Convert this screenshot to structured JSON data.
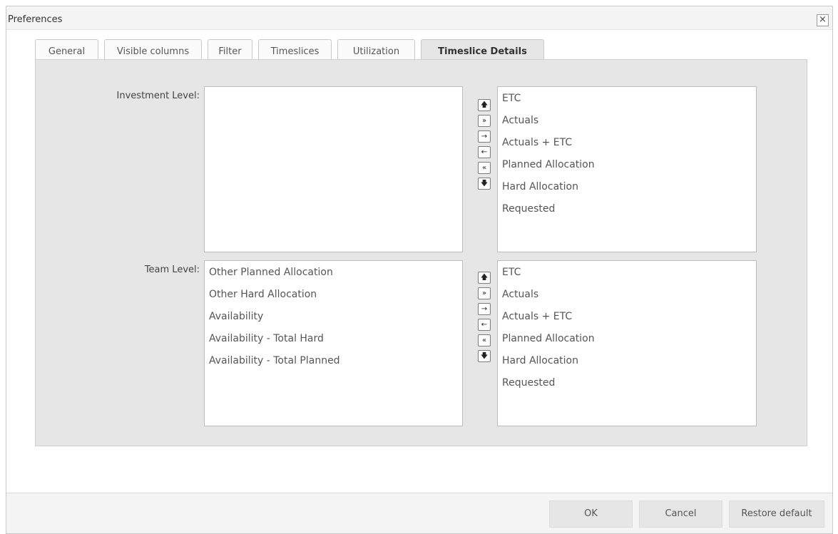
{
  "dialog": {
    "title": "Preferences",
    "close_glyph": "×"
  },
  "tabs": [
    {
      "label": "General"
    },
    {
      "label": "Visible columns"
    },
    {
      "label": "Filter"
    },
    {
      "label": "Timeslices"
    },
    {
      "label": "Utilization"
    },
    {
      "label": "Timeslice Details",
      "active": true
    }
  ],
  "investment": {
    "label": "Investment Level:",
    "available": [],
    "selected": [
      "ETC",
      "Actuals",
      "Actuals + ETC",
      "Planned Allocation",
      "Hard Allocation",
      "Requested"
    ]
  },
  "team": {
    "label": "Team Level:",
    "available": [
      "Other Planned Allocation",
      "Other Hard Allocation",
      "Availability",
      "Availability - Total Hard",
      "Availability - Total Planned"
    ],
    "selected": [
      "ETC",
      "Actuals",
      "Actuals + ETC",
      "Planned Allocation",
      "Hard Allocation",
      "Requested"
    ]
  },
  "arrows": {
    "up": "🡅",
    "add_all": "»",
    "add": "→",
    "remove": "←",
    "remove_all": "«",
    "down": "🡇"
  },
  "footer": {
    "ok": "OK",
    "cancel": "Cancel",
    "restore": "Restore default"
  }
}
